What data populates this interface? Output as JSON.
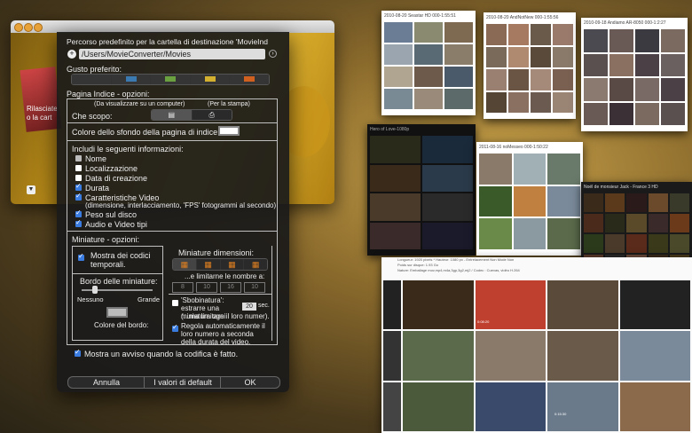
{
  "panel": {
    "dest_label": "Percorso predefinito per la cartella di destinazione 'MovieInd",
    "dest_path": "/Users/MovieConverter/Movies",
    "preferred_label": "Gusto preferito:",
    "index_options_label": "Pagina Indice - opzioni:",
    "computer_hint": "(Da visualizzare su un computer)",
    "print_hint": "(Per la stampa)",
    "scope_label": "Che scopo:",
    "bg_color_label": "Colore dello sfondo della pagina di indice:",
    "include_label": "Includi le seguenti informazioni:",
    "include_items": [
      {
        "label": "Nome",
        "state": "gray"
      },
      {
        "label": "Localizzazione",
        "state": "off"
      },
      {
        "label": "Data di creazione",
        "state": "off"
      },
      {
        "label": "Durata",
        "state": "on"
      },
      {
        "label": "Caratteristiche Video",
        "state": "on"
      },
      {
        "label": "(dimensione, interlacciamento, 'FPS' fotogrammi al secondo)",
        "state": "none"
      },
      {
        "label": "Peso sul disco",
        "state": "on"
      },
      {
        "label": "Audio e Video tipi",
        "state": "on"
      }
    ],
    "thumb_options_label": "Miniature - opzioni:",
    "show_codes_label": "Mostra dei codici temporali.",
    "border_label": "Bordo delle miniature:",
    "none_label": "Nessuno",
    "large_label": "Grande",
    "border_color_label": "Colore del bordo:",
    "thumb_dims_label": "Miniature dimensioni:",
    "limit_label": "...e limitarne le nombre a:",
    "steppers": [
      "8",
      "10",
      "16",
      "10"
    ],
    "skim_label": "'Sbobinatura': estrarre una miniatura ogni",
    "skim_value": "20",
    "skim_unit": "sec.",
    "skim_note": "(...ma limitare il loro numer).",
    "auto_label": "Regola automaticamente il loro numero a seconda della durata del video.",
    "notify_label": "Mostra un avviso quando la codifica è fatto.",
    "cancel": "Annulla",
    "defaults": "I valori di default",
    "ok": "OK"
  },
  "background": {
    "app_text_1": "Rilasciate",
    "app_text_2": "o la cart",
    "sheet_titles": [
      "2010-08-20 Seastar HD 000-1:55:51",
      "2010-08-20 AndNotNew 000-1:55:56",
      "2010-09-18 Andiamo AR-8050 000-1:2:27",
      "Hero of Love-1080p",
      "2011-08-16 noMesseo 000-1:50:22",
      "Noël de monsieur Jack - France 3 HD"
    ],
    "info_rows": [
      "Longueur: 1920 pixels * Hauteur: 1080 px - Entrelacement Non Mode Non",
      "Poids sur disque: 1.93 Go",
      "Nature: Emballage mov,mp4,m4a,3gp,3g2,mj2 / Codec : Cuevas, vidéo H.264"
    ],
    "timestamps": [
      "0:08:20",
      "0:15:30"
    ]
  },
  "colors": {
    "checkbox_on": "#3a7be0"
  }
}
